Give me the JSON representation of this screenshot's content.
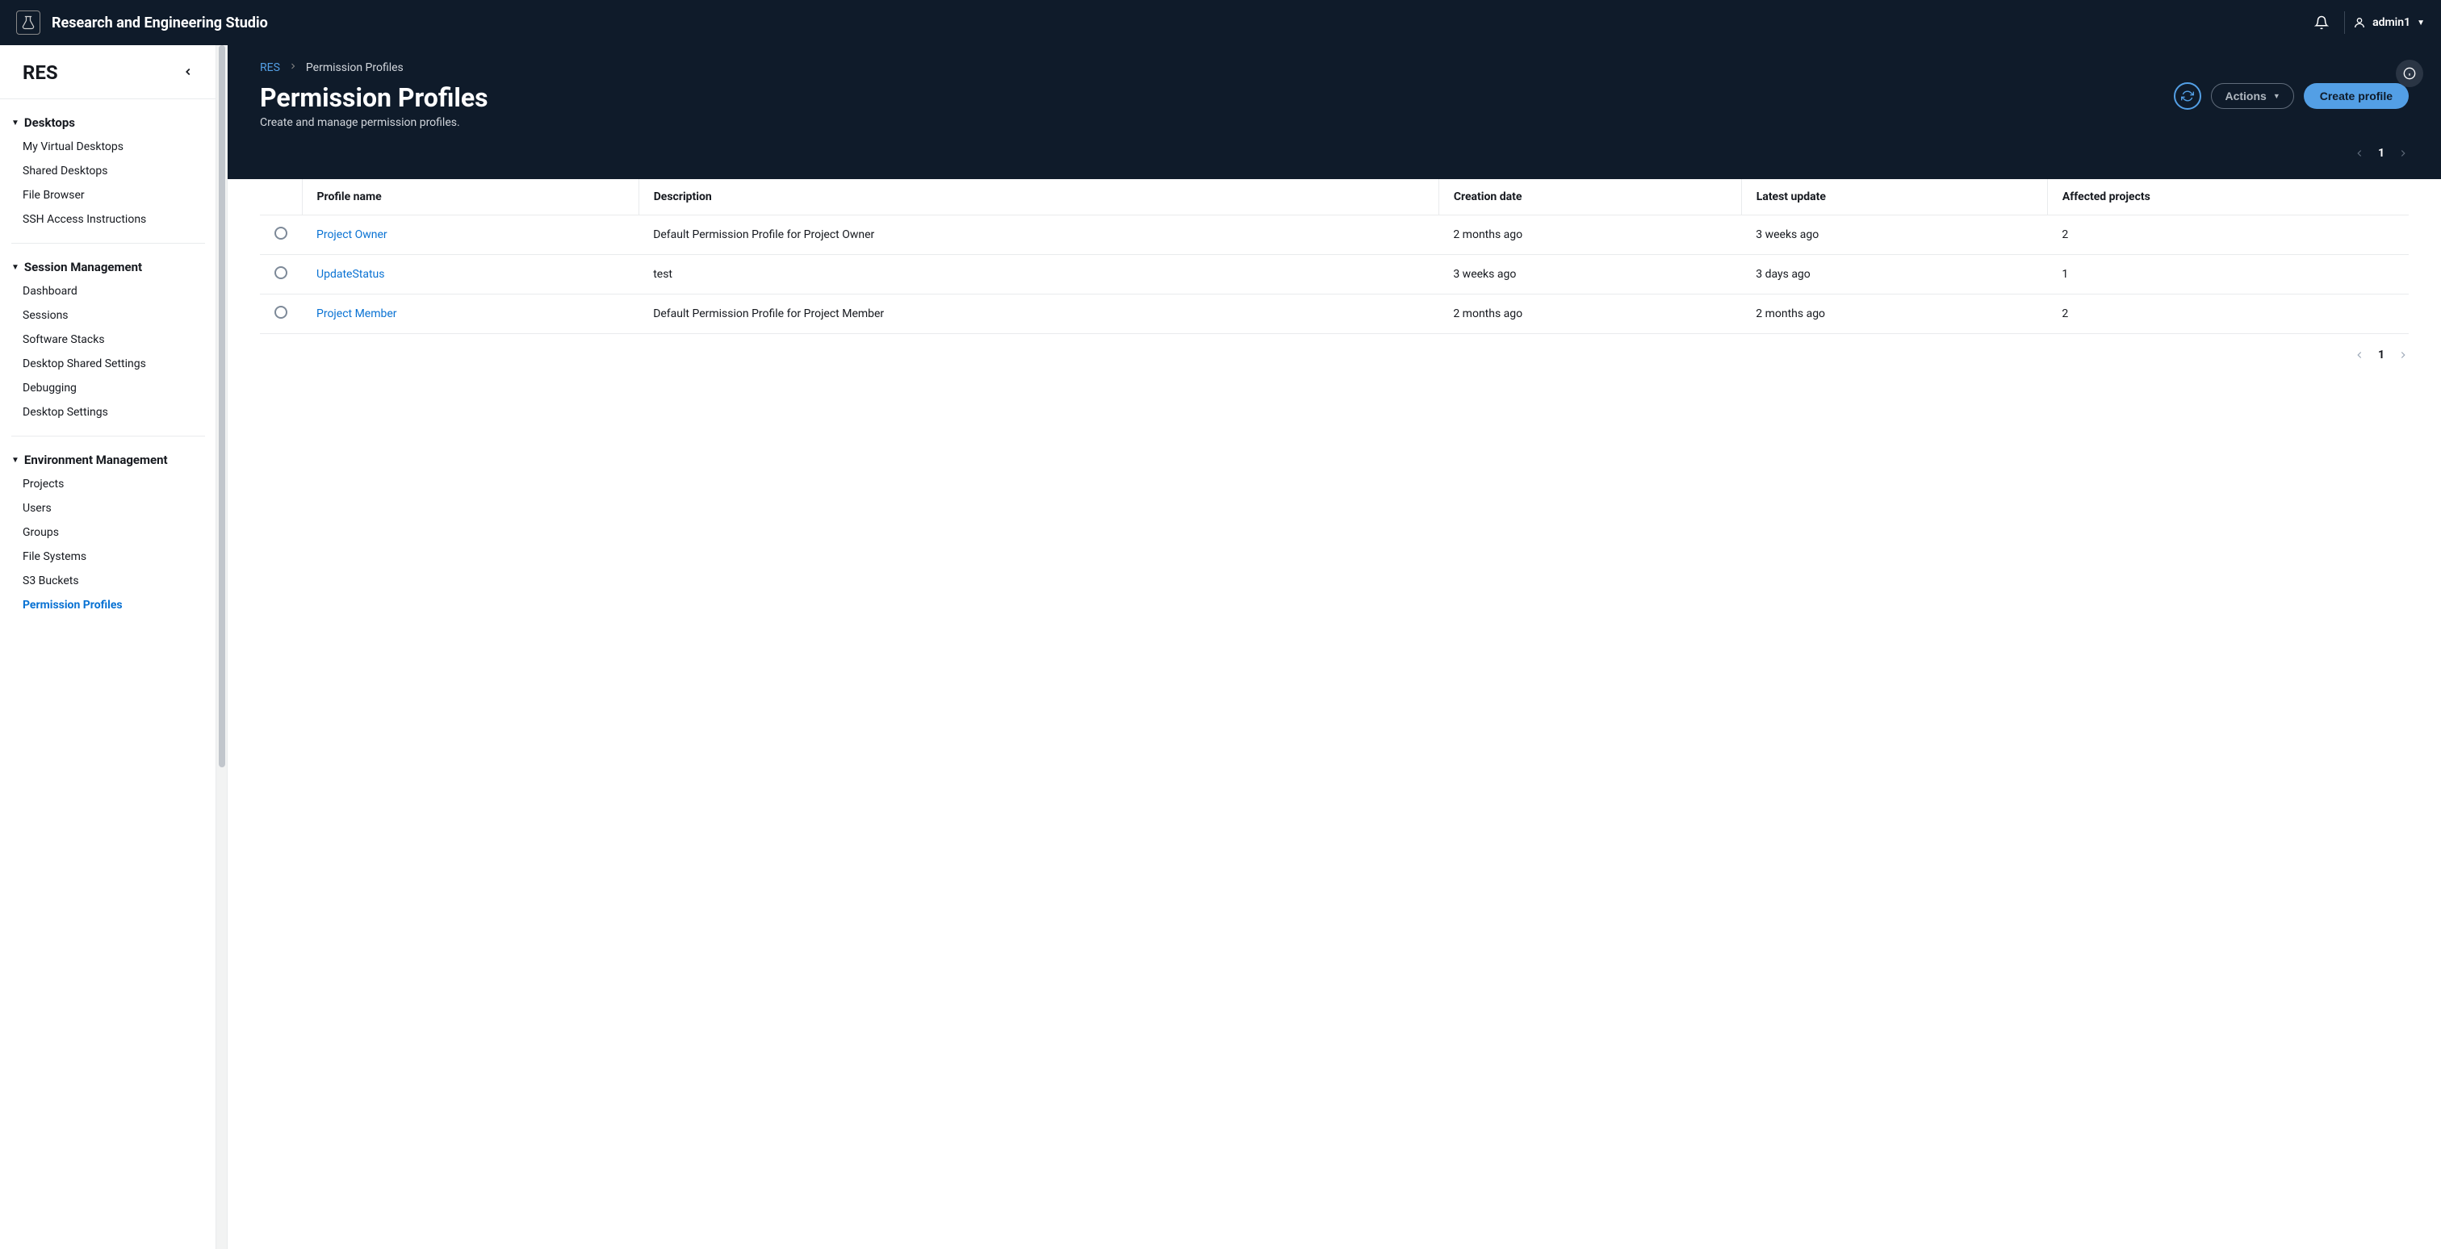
{
  "topbar": {
    "app_title": "Research and Engineering Studio",
    "username": "admin1"
  },
  "sidebar": {
    "title": "RES",
    "sections": [
      {
        "title": "Desktops",
        "items": [
          {
            "label": "My Virtual Desktops",
            "active": false
          },
          {
            "label": "Shared Desktops",
            "active": false
          },
          {
            "label": "File Browser",
            "active": false
          },
          {
            "label": "SSH Access Instructions",
            "active": false
          }
        ]
      },
      {
        "title": "Session Management",
        "items": [
          {
            "label": "Dashboard",
            "active": false
          },
          {
            "label": "Sessions",
            "active": false
          },
          {
            "label": "Software Stacks",
            "active": false
          },
          {
            "label": "Desktop Shared Settings",
            "active": false
          },
          {
            "label": "Debugging",
            "active": false
          },
          {
            "label": "Desktop Settings",
            "active": false
          }
        ]
      },
      {
        "title": "Environment Management",
        "items": [
          {
            "label": "Projects",
            "active": false
          },
          {
            "label": "Users",
            "active": false
          },
          {
            "label": "Groups",
            "active": false
          },
          {
            "label": "File Systems",
            "active": false
          },
          {
            "label": "S3 Buckets",
            "active": false
          },
          {
            "label": "Permission Profiles",
            "active": true
          }
        ]
      }
    ]
  },
  "breadcrumb": {
    "root": "RES",
    "current": "Permission Profiles"
  },
  "page": {
    "title": "Permission Profiles",
    "subtitle": "Create and manage permission profiles.",
    "actions_label": "Actions",
    "create_label": "Create profile"
  },
  "pagination": {
    "page": "1"
  },
  "table": {
    "headers": {
      "name": "Profile name",
      "desc": "Description",
      "created": "Creation date",
      "updated": "Latest update",
      "affected": "Affected projects"
    },
    "rows": [
      {
        "name": "Project Owner",
        "desc": "Default Permission Profile for Project Owner",
        "created": "2 months ago",
        "updated": "3 weeks ago",
        "affected": "2"
      },
      {
        "name": "UpdateStatus",
        "desc": "test",
        "created": "3 weeks ago",
        "updated": "3 days ago",
        "affected": "1"
      },
      {
        "name": "Project Member",
        "desc": "Default Permission Profile for Project Member",
        "created": "2 months ago",
        "updated": "2 months ago",
        "affected": "2"
      }
    ]
  }
}
